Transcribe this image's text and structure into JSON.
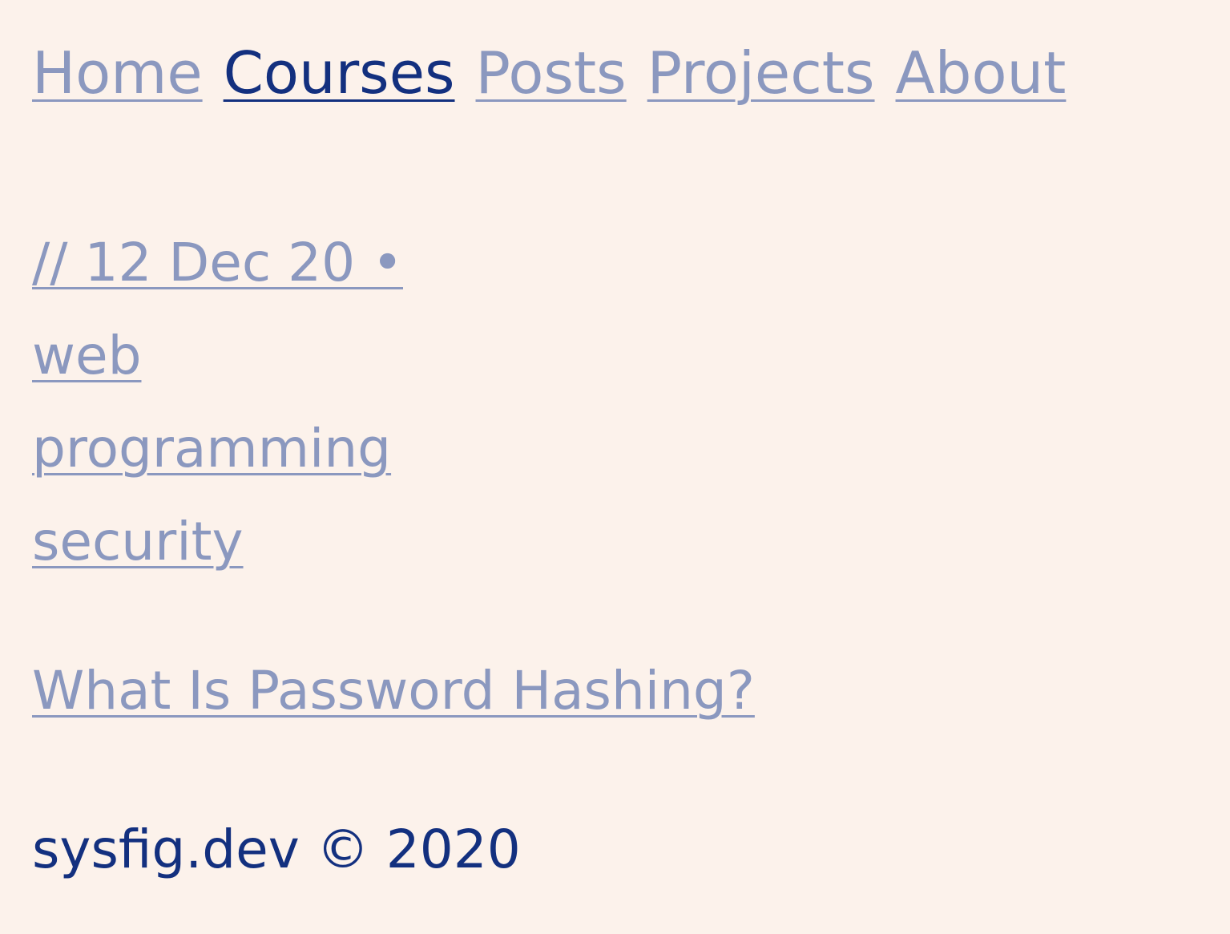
{
  "nav": {
    "items": [
      {
        "label": "Home"
      },
      {
        "label": "Courses"
      },
      {
        "label": "Posts"
      },
      {
        "label": "Projects"
      },
      {
        "label": "About"
      }
    ]
  },
  "post": {
    "date": "// 12 Dec 20 •",
    "tags": [
      "web",
      "programming",
      "security"
    ],
    "title": "What Is Password Hashing?"
  },
  "footer": {
    "text": "sysfig.dev © 2020"
  },
  "colors": {
    "background": "#fcf2eb",
    "link": "#8b98bf",
    "active": "#13307f"
  }
}
